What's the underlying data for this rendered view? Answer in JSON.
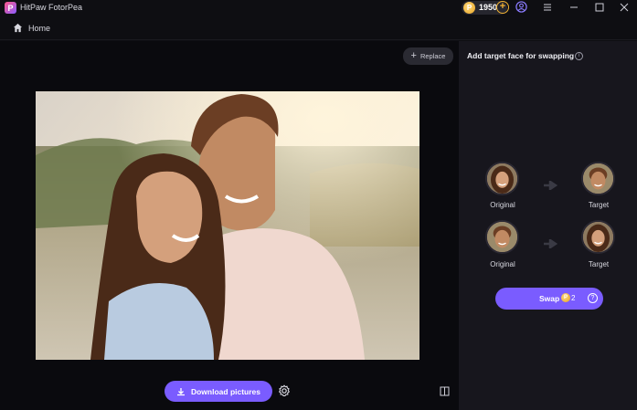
{
  "app": {
    "title": "HitPaw FotorPea",
    "logo_letter": "P",
    "coins": "1950",
    "coin_symbol": "P",
    "add_coins_symbol": "+"
  },
  "nav": {
    "home_label": "Home"
  },
  "canvas": {
    "replace_label": "Replace",
    "replace_symbol": "+",
    "download_label": "Download pictures"
  },
  "panel": {
    "title": "Add target face for swapping",
    "info_symbol": "i",
    "pairs": [
      {
        "original_label": "Original",
        "target_label": "Target"
      },
      {
        "original_label": "Original",
        "target_label": "Target"
      }
    ],
    "swap": {
      "label": "Swap",
      "coin_symbol": "P",
      "cost": "2",
      "help_symbol": "?"
    }
  },
  "colors": {
    "accent": "#7a5cff",
    "background": "#0e0e12",
    "panel": "#17161d",
    "coin": "#f2b233"
  }
}
